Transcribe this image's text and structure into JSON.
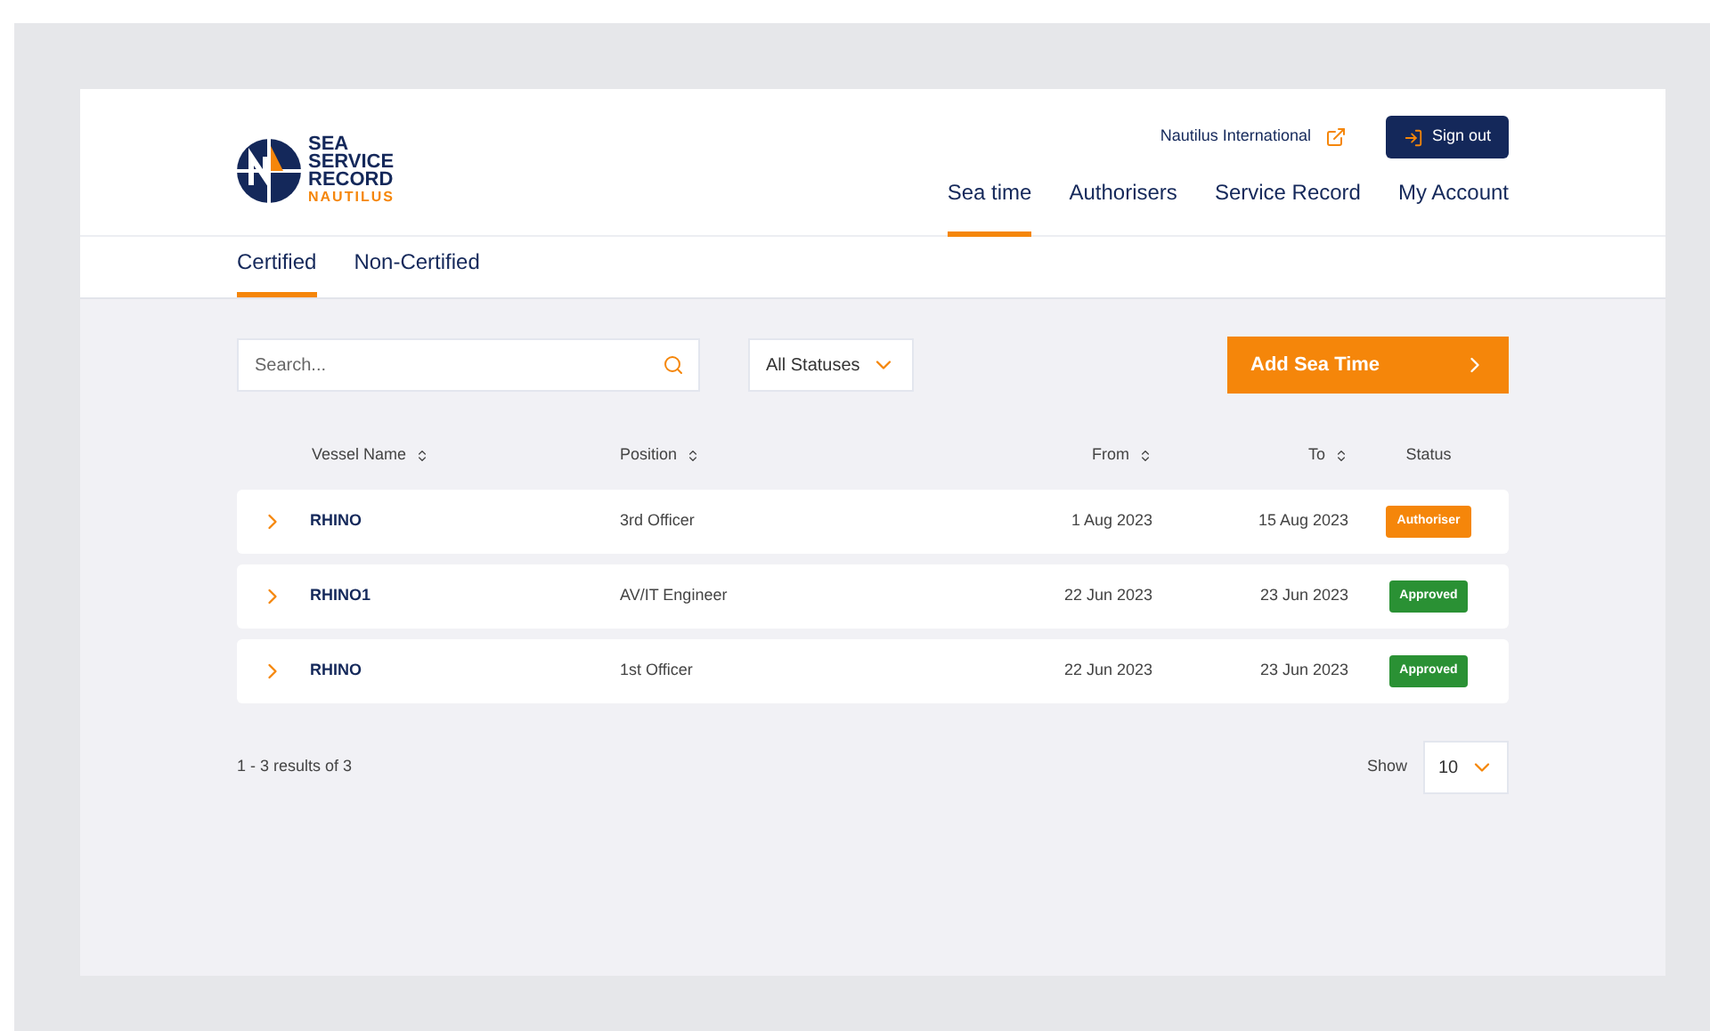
{
  "logo": {
    "lines": [
      "SEA",
      "SERVICE",
      "RECORD"
    ],
    "sub": "NAUTILUS"
  },
  "top_link": "Nautilus International",
  "sign_out": "Sign out",
  "nav": [
    {
      "label": "Sea time",
      "selected": true
    },
    {
      "label": "Authorisers",
      "selected": false
    },
    {
      "label": "Service Record",
      "selected": false
    },
    {
      "label": "My Account",
      "selected": false
    }
  ],
  "tabs": [
    {
      "label": "Certified",
      "selected": true
    },
    {
      "label": "Non-Certified",
      "selected": false
    }
  ],
  "search": {
    "placeholder": "Search..."
  },
  "status_filter": "All Statuses",
  "add_button": "Add Sea Time",
  "table": {
    "columns": [
      "Vessel Name",
      "Position",
      "From",
      "To",
      "Status"
    ],
    "rows": [
      {
        "vessel": "RHINO",
        "position": "3rd Officer",
        "from": "1 Aug 2023",
        "to": "15 Aug 2023",
        "status": "Authoriser",
        "color": "#f5860a"
      },
      {
        "vessel": "RHINO1",
        "position": "AV/IT Engineer",
        "from": "22 Jun 2023",
        "to": "23 Jun 2023",
        "status": "Approved",
        "color": "#2a9134"
      },
      {
        "vessel": "RHINO",
        "position": "1st Officer",
        "from": "22 Jun 2023",
        "to": "23 Jun 2023",
        "status": "Approved",
        "color": "#2a9134"
      }
    ]
  },
  "results": "1 - 3 results of 3",
  "show_label": "Show",
  "show_value": "10"
}
